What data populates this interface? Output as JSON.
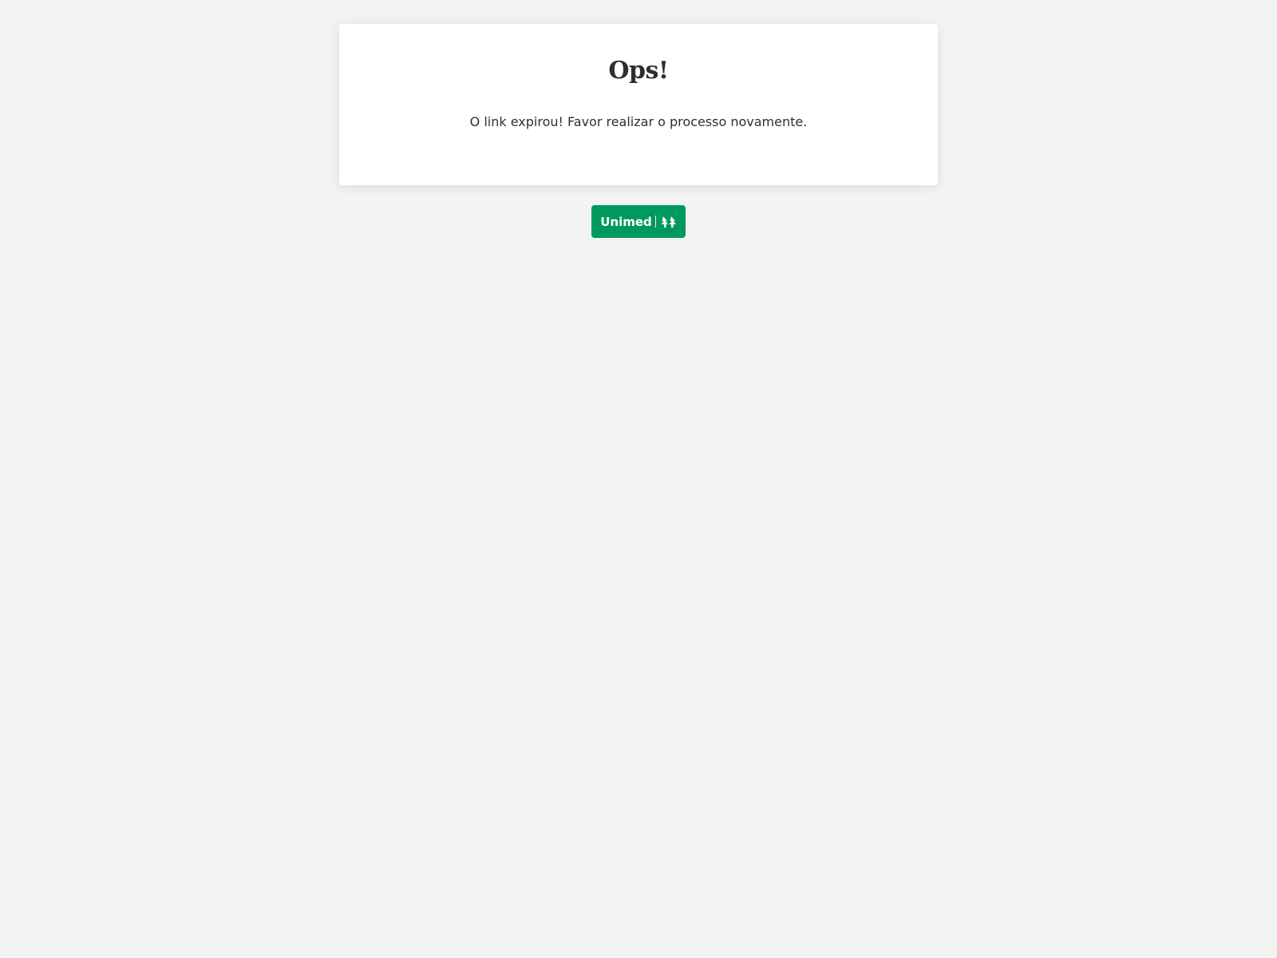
{
  "card": {
    "title": "Ops!",
    "message": "O link expirou! Favor realizar o processo novamente."
  },
  "logo": {
    "text": "Unimed",
    "icon": "unimed-trees-icon",
    "background": "#00995d",
    "foreground": "#ffffff"
  },
  "colors": {
    "page_background": "#f3f3f3",
    "card_background": "#ffffff",
    "text_primary": "#2e2e2e",
    "brand_green": "#00995d"
  }
}
